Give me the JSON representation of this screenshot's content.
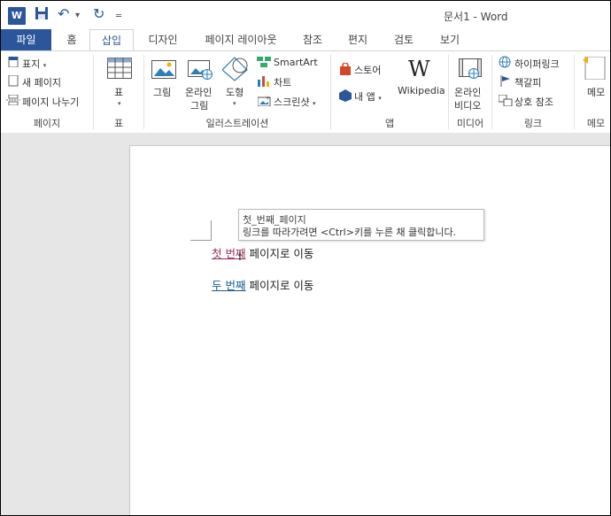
{
  "window": {
    "title": "문서1 - Word",
    "app_badge": "W"
  },
  "qat": {
    "save_icon": "save-icon",
    "undo_icon": "undo-icon",
    "redo_icon": "redo-icon",
    "customize_icon": "customize-icon"
  },
  "tabs": [
    {
      "label": "파일"
    },
    {
      "label": "홈"
    },
    {
      "label": "삽입"
    },
    {
      "label": "디자인"
    },
    {
      "label": "페이지 레이아웃"
    },
    {
      "label": "참조"
    },
    {
      "label": "편지"
    },
    {
      "label": "검토"
    },
    {
      "label": "보기"
    }
  ],
  "ribbon": {
    "pages": {
      "cover": "표지",
      "blank": "새 페이지",
      "break": "페이지 나누기",
      "label": "페이지"
    },
    "tables": {
      "table": "표",
      "label": "표"
    },
    "illustrations": {
      "picture": "그림",
      "online_picture_1": "온라인",
      "online_picture_2": "그림",
      "shapes": "도형",
      "smartart": "SmartArt",
      "chart": "차트",
      "screenshot": "스크린샷",
      "label": "일러스트레이션"
    },
    "apps": {
      "store": "스토어",
      "my_apps": "내 앱",
      "wikipedia": "Wikipedia",
      "label": "앱"
    },
    "media": {
      "video_1": "온라인",
      "video_2": "비디오",
      "label": "미디어"
    },
    "links": {
      "hyperlink": "하이퍼링크",
      "bookmark": "책갈피",
      "crossref": "상호 참조",
      "label": "링크"
    },
    "comments": {
      "comment": "메모",
      "label": "메모"
    }
  },
  "tooltip": {
    "title": "첫_번째_페이지",
    "body": "링크를 따라가려면 <Ctrl>키를 누른 채 클릭합니다."
  },
  "document": {
    "line1": {
      "link": "첫 번째",
      "rest": " 페이지로 이동"
    },
    "line2": {
      "link": "두 번째",
      "rest": " 페이지로 이동"
    }
  }
}
